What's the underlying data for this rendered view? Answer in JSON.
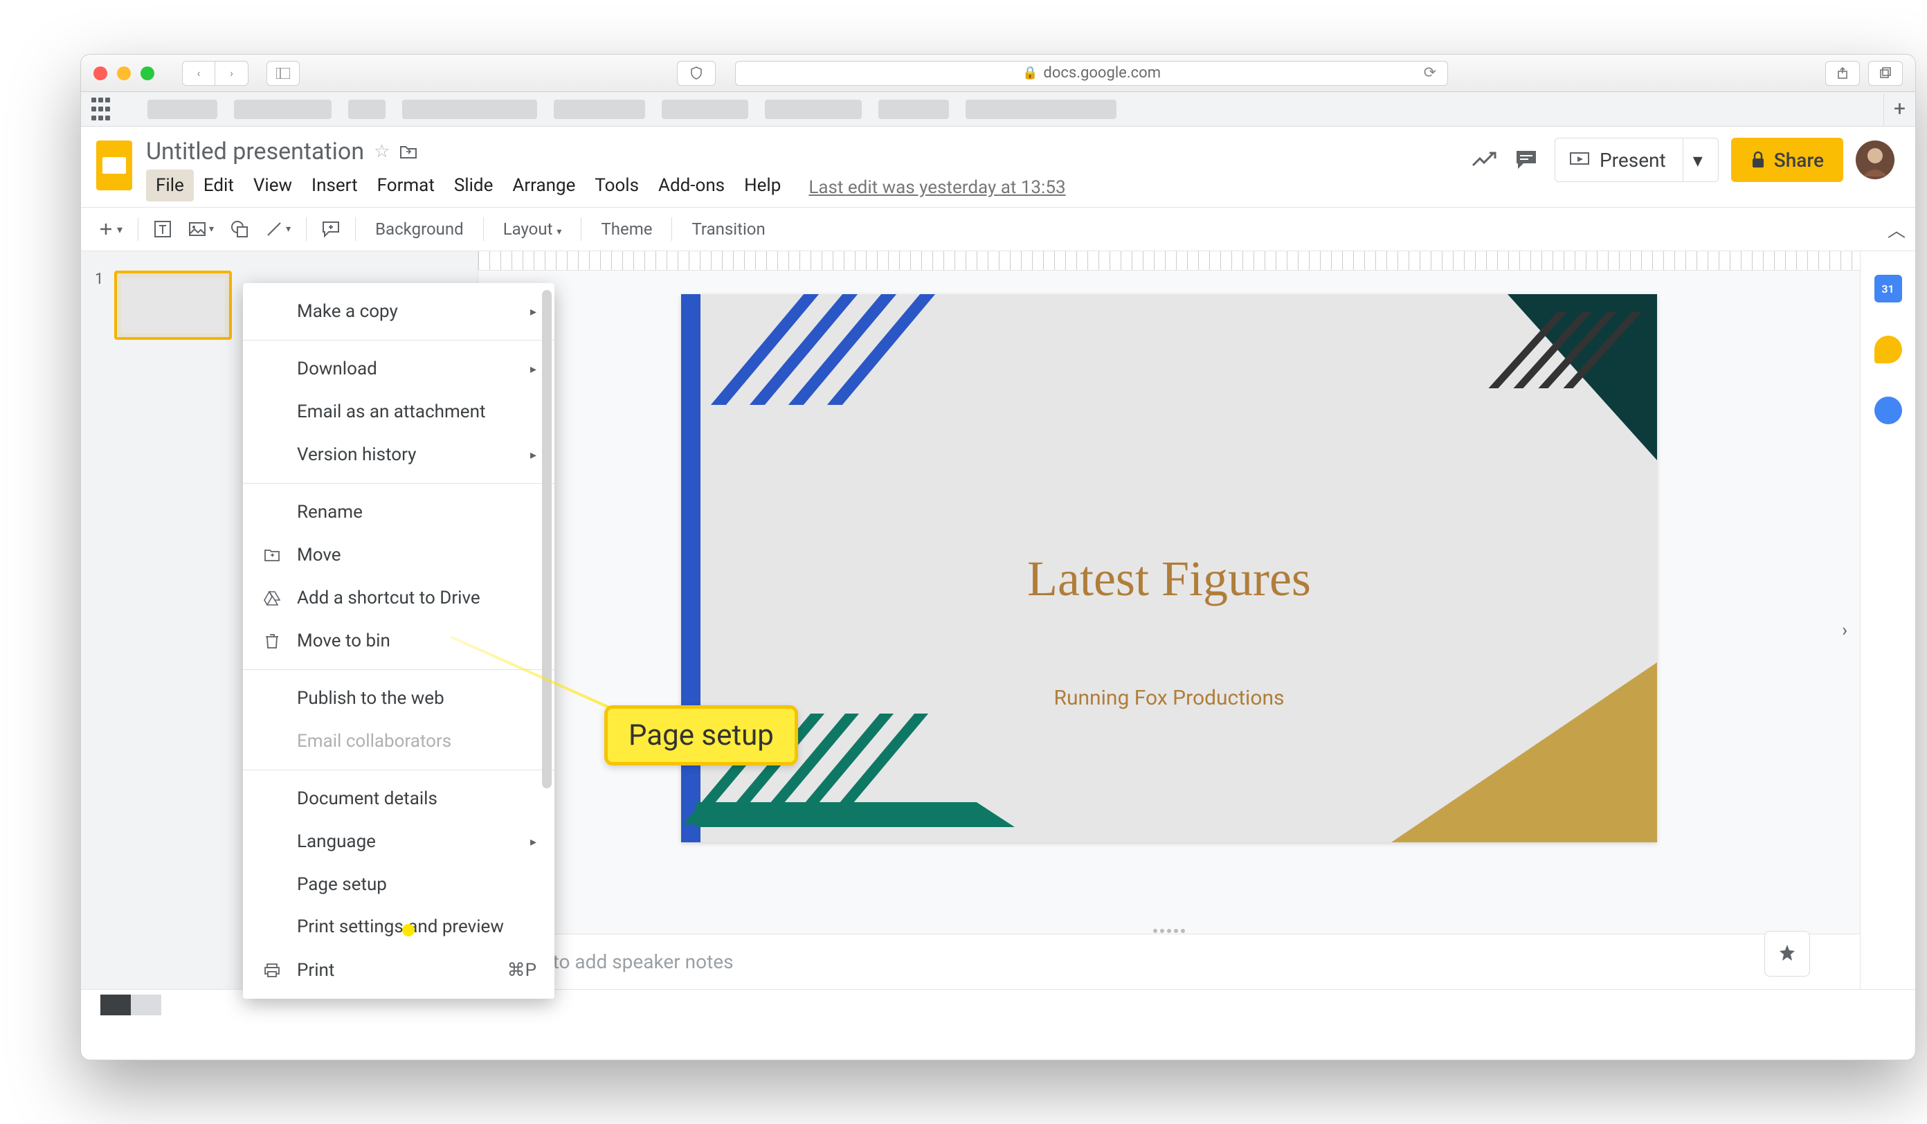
{
  "browser": {
    "url": "docs.google.com"
  },
  "header": {
    "title": "Untitled presentation",
    "menus": [
      "File",
      "Edit",
      "View",
      "Insert",
      "Format",
      "Slide",
      "Arrange",
      "Tools",
      "Add-ons",
      "Help"
    ],
    "last_edit": "Last edit was yesterday at 13:53",
    "present_label": "Present",
    "share_label": "Share"
  },
  "toolbar": {
    "background": "Background",
    "layout": "Layout",
    "theme": "Theme",
    "transition": "Transition"
  },
  "slide_panel": {
    "thumbs": [
      {
        "num": "1"
      }
    ]
  },
  "slide": {
    "title": "Latest Figures",
    "subtitle": "Running Fox Productions"
  },
  "notes": {
    "placeholder": "Click to add speaker notes"
  },
  "file_menu": {
    "make_copy": "Make a copy",
    "download": "Download",
    "email_attach": "Email as an attachment",
    "version_history": "Version history",
    "rename": "Rename",
    "move": "Move",
    "add_shortcut": "Add a shortcut to Drive",
    "move_bin": "Move to bin",
    "publish": "Publish to the web",
    "email_collab": "Email collaborators",
    "doc_details": "Document details",
    "language": "Language",
    "page_setup": "Page setup",
    "print_settings": "Print settings and preview",
    "print": "Print",
    "print_shortcut": "⌘P"
  },
  "callout": {
    "label": "Page setup"
  }
}
